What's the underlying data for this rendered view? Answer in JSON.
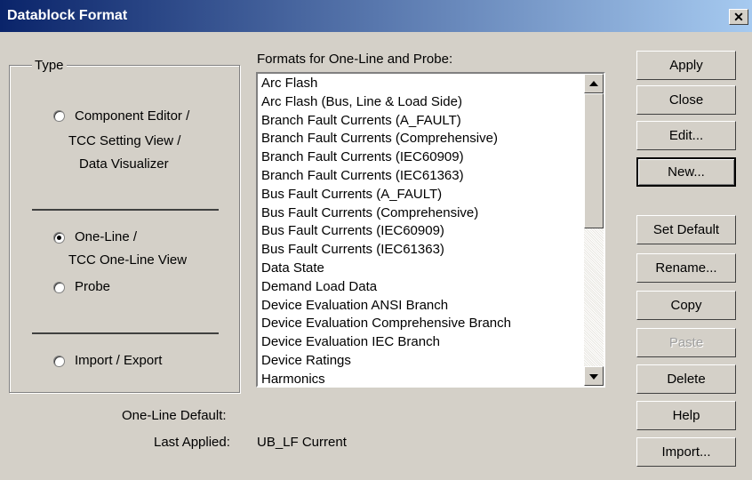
{
  "window": {
    "title": "Datablock Format",
    "close_glyph": "✕"
  },
  "type_group": {
    "label": "Type",
    "options": [
      {
        "line1": "Component Editor /",
        "line2": "TCC Setting View /",
        "line3": "Data Visualizer",
        "checked": false
      },
      {
        "line1": "One-Line /",
        "line2": "TCC One-Line View",
        "checked": true
      },
      {
        "line1": "Probe",
        "checked": false
      },
      {
        "line1": "Import / Export",
        "checked": false
      }
    ]
  },
  "formats": {
    "label": "Formats for One-Line and Probe:",
    "items": [
      "Arc Flash",
      "Arc Flash (Bus, Line & Load Side)",
      "Branch Fault Currents (A_FAULT)",
      "Branch Fault Currents (Comprehensive)",
      "Branch Fault Currents (IEC60909)",
      "Branch Fault Currents (IEC61363)",
      "Bus Fault Currents (A_FAULT)",
      "Bus Fault Currents (Comprehensive)",
      "Bus Fault Currents (IEC60909)",
      "Bus Fault Currents (IEC61363)",
      "Data State",
      "Demand Load Data",
      "Device Evaluation ANSI Branch",
      "Device Evaluation Comprehensive Branch",
      "Device Evaluation IEC Branch",
      "Device Ratings",
      "Harmonics"
    ]
  },
  "info": {
    "default_label": "One-Line Default:",
    "default_value": "",
    "applied_label": "Last Applied:",
    "applied_value": "UB_LF Current"
  },
  "buttons": {
    "apply": "Apply",
    "close": "Close",
    "edit": "Edit...",
    "new": "New...",
    "set_default": "Set Default",
    "rename": "Rename...",
    "copy": "Copy",
    "paste": "Paste",
    "delete": "Delete",
    "help": "Help",
    "import": "Import..."
  }
}
